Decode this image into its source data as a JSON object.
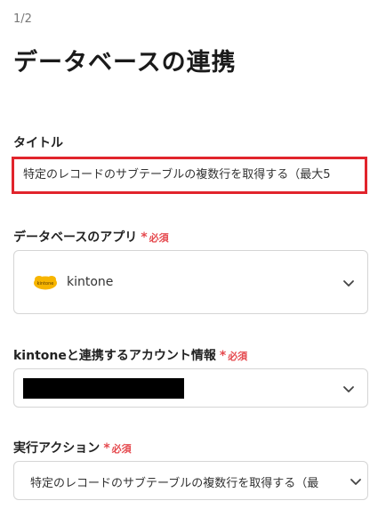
{
  "header": {
    "step": "1/2",
    "title": "データベースの連携"
  },
  "fields": {
    "title": {
      "label": "タイトル",
      "value": "特定のレコードのサブテーブルの複数行を取得する（最大5"
    },
    "app": {
      "label": "データベースのアプリ",
      "required_mark": "*",
      "required_text": "必須",
      "selected": "kintone",
      "logo_text": "kintone",
      "logo_color": "#F7B500"
    },
    "account": {
      "label": "kintoneと連携するアカウント情報",
      "required_mark": "*",
      "required_text": "必須"
    },
    "action": {
      "label": "実行アクション",
      "required_mark": "*",
      "required_text": "必須",
      "selected": "特定のレコードのサブテーブルの複数行を取得する（最"
    }
  },
  "colors": {
    "required": "#e5484d",
    "highlight_border": "#e1242c"
  }
}
